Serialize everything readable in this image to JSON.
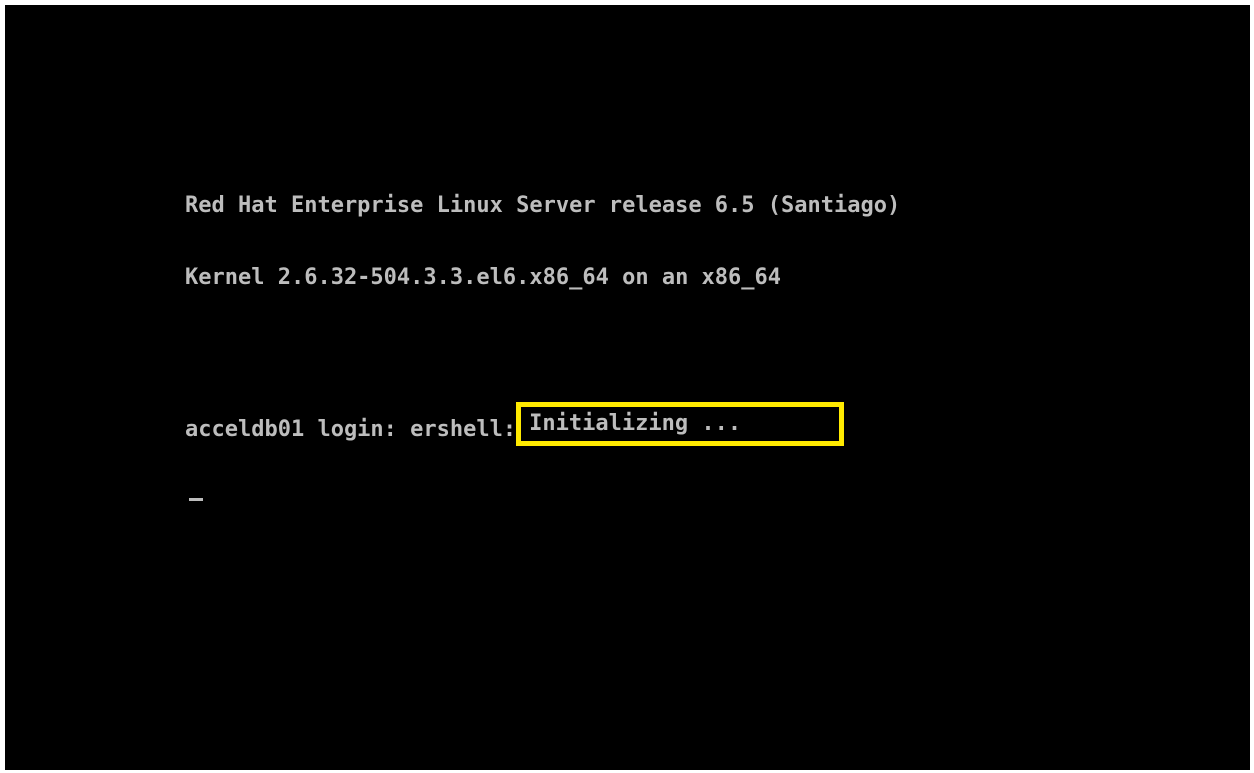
{
  "console": {
    "line1": "Red Hat Enterprise Linux Server release 6.5 (Santiago)",
    "line2": "Kernel 2.6.32-504.3.3.el6.x86_64 on an x86_64",
    "login_prompt": "acceldb01 login: ershell:",
    "status_text": "Initializing ..."
  },
  "colors": {
    "background": "#000000",
    "text": "#bdbdbd",
    "highlight": "#ffea00"
  }
}
